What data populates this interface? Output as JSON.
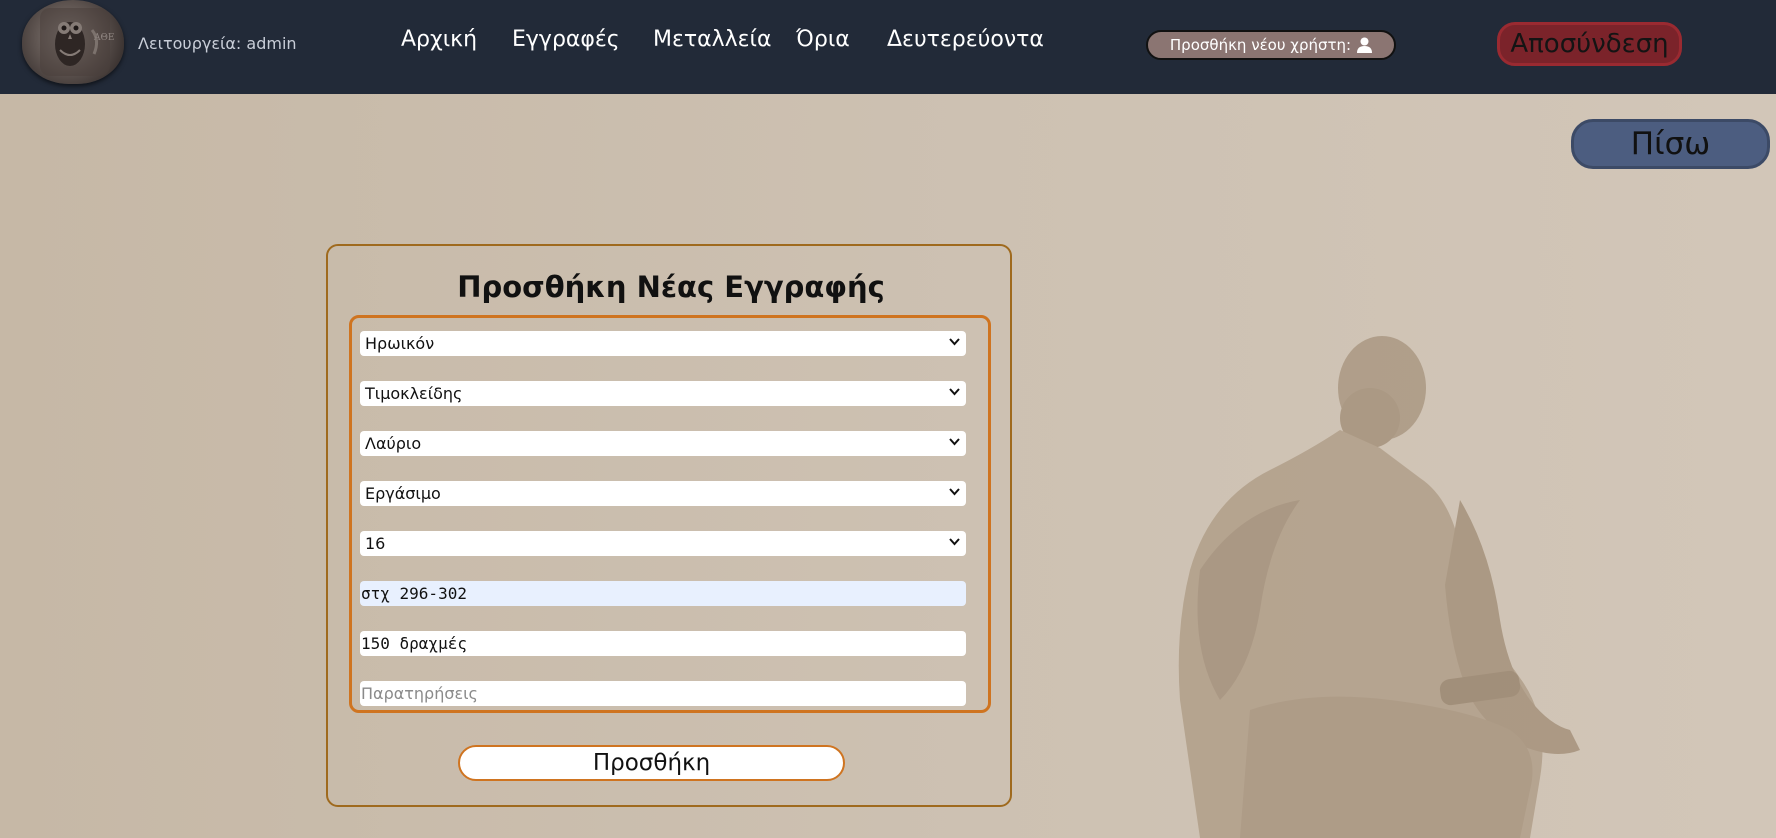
{
  "header": {
    "mode_text": "Λειτουργεία: admin",
    "nav": [
      "Αρχική",
      "Εγγραφές",
      "Μεταλλεία",
      "Όρια",
      "Δευτερεύοντα"
    ],
    "add_user_label": "Προσθήκη νέου χρήστη:",
    "add_user_icon": "user-icon",
    "logout_label": "Αποσύνδεση"
  },
  "back_label": "Πίσω",
  "form": {
    "title": "Προσθήκη Νέας Εγγραφής",
    "selects": [
      "Ηρωικόν",
      "Τιμοκλείδης",
      "Λαύριο",
      "Εργάσιμο",
      "16"
    ],
    "inputs": {
      "location": "στχ 296-302",
      "price": "150 δραχμές",
      "notes_placeholder": "Παρατηρήσεις"
    },
    "submit_label": "Προσθήκη"
  },
  "colors": {
    "navbar": "#222a38",
    "accent_orange": "#cf7420",
    "logout_red": "#7b232a",
    "back_blue": "#4c5d80",
    "add_user_bg": "#8b7572"
  }
}
